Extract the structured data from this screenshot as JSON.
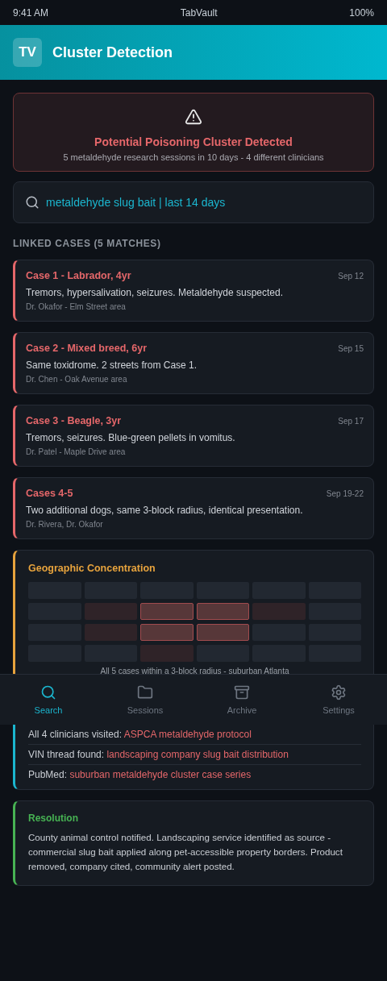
{
  "status_bar": {
    "time": "9:41 AM",
    "title": "TabVault",
    "battery": "100%"
  },
  "header": {
    "logo": "TV",
    "title": "Cluster Detection"
  },
  "alert": {
    "title": "Potential Poisoning Cluster Detected",
    "subtitle": "5 metaldehyde research sessions in 10 days - 4 different clinicians"
  },
  "search": {
    "value": "metaldehyde slug bait | last 14 days"
  },
  "section_label": "LINKED CASES (5 MATCHES)",
  "cases": [
    {
      "title": "Case 1 - Labrador, 4yr",
      "date": "Sep 12",
      "summary": "Tremors, hypersalivation, seizures. Metaldehyde suspected.",
      "meta": "Dr. Okafor - Elm Street area"
    },
    {
      "title": "Case 2 - Mixed breed, 6yr",
      "date": "Sep 15",
      "summary": "Same toxidrome. 2 streets from Case 1.",
      "meta": "Dr. Chen - Oak Avenue area"
    },
    {
      "title": "Case 3 - Beagle, 3yr",
      "date": "Sep 17",
      "summary": "Tremors, seizures. Blue-green pellets in vomitus.",
      "meta": "Dr. Patel - Maple Drive area"
    },
    {
      "title": "Cases 4-5",
      "date": "Sep 19-22",
      "summary": "Two additional dogs, same 3-block radius, identical presentation.",
      "meta": "Dr. Rivera, Dr. Okafor"
    }
  ],
  "geo": {
    "title": "Geographic Concentration",
    "grid": [
      [
        {
          "kind": "none"
        },
        {
          "kind": "none"
        },
        {
          "kind": "none"
        },
        {
          "kind": "none"
        },
        {
          "kind": "none"
        },
        {
          "kind": "none"
        }
      ],
      [
        {
          "kind": "none"
        },
        {
          "kind": "low"
        },
        {
          "kind": "high"
        },
        {
          "kind": "high"
        },
        {
          "kind": "low"
        },
        {
          "kind": "none"
        }
      ],
      [
        {
          "kind": "none"
        },
        {
          "kind": "low"
        },
        {
          "kind": "high"
        },
        {
          "kind": "high"
        },
        {
          "kind": "none"
        },
        {
          "kind": "none"
        }
      ],
      [
        {
          "kind": "none"
        },
        {
          "kind": "none"
        },
        {
          "kind": "low"
        },
        {
          "kind": "none"
        },
        {
          "kind": "none"
        },
        {
          "kind": "none"
        }
      ]
    ],
    "caption": "All 5 cases within a 3-block radius - suburban Atlanta"
  },
  "findings": [
    {
      "prefix": "All 4 clinicians visited:",
      "link": "ASPCA metaldehyde protocol"
    },
    {
      "prefix": "VIN thread found:",
      "link": "landscaping company slug bait distribution"
    },
    {
      "prefix": "PubMed:",
      "link": "suburban metaldehyde cluster case series"
    }
  ],
  "resolution": {
    "title": "Resolution",
    "text": "County animal control notified. Landscaping service identified as source - commercial slug bait applied along pet-accessible property borders. Product removed, company cited, community alert posted."
  },
  "nav": [
    {
      "kind": "search",
      "label": "Search",
      "selected": true
    },
    {
      "kind": "sessions",
      "label": "Sessions",
      "selected": false
    },
    {
      "kind": "archive",
      "label": "Archive",
      "selected": false
    },
    {
      "kind": "settings",
      "label": "Settings",
      "selected": false
    }
  ]
}
